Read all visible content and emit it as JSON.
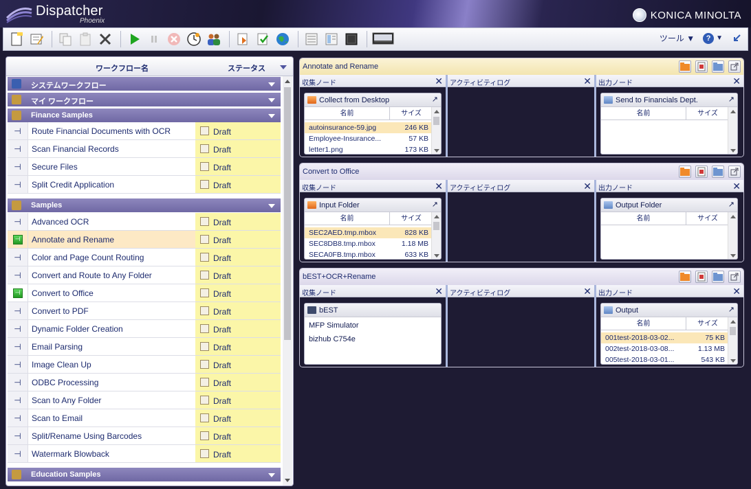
{
  "app": {
    "name": "Dispatcher",
    "subtitle": "Phoenix",
    "brand": "KONICA MINOLTA"
  },
  "toolbar": {
    "tools_label": "ツール ▼",
    "help_label": "?",
    "help_arrow": "▼"
  },
  "left_panel": {
    "col_name": "ワークフロー名",
    "col_status": "ステータス",
    "groups": [
      {
        "label": "システムワークフロー"
      },
      {
        "label": "マイ ワークフロー"
      },
      {
        "label": "Finance Samples"
      },
      {
        "label": "Samples"
      },
      {
        "label": "Education Samples"
      }
    ],
    "finance_rows": [
      {
        "name": "Route Financial Documents with OCR",
        "status": "Draft"
      },
      {
        "name": "Scan Financial Records",
        "status": "Draft"
      },
      {
        "name": "Secure Files",
        "status": "Draft"
      },
      {
        "name": "Split Credit Application",
        "status": "Draft"
      }
    ],
    "sample_rows": [
      {
        "name": "Advanced OCR",
        "status": "Draft"
      },
      {
        "name": "Annotate and Rename",
        "status": "Draft"
      },
      {
        "name": "Color and Page Count Routing",
        "status": "Draft"
      },
      {
        "name": "Convert and Route to Any Folder",
        "status": "Draft"
      },
      {
        "name": "Convert to Office",
        "status": "Draft"
      },
      {
        "name": "Convert to PDF",
        "status": "Draft"
      },
      {
        "name": "Dynamic Folder Creation",
        "status": "Draft"
      },
      {
        "name": "Email Parsing",
        "status": "Draft"
      },
      {
        "name": "Image Clean Up",
        "status": "Draft"
      },
      {
        "name": "ODBC Processing",
        "status": "Draft"
      },
      {
        "name": "Scan to Any Folder",
        "status": "Draft"
      },
      {
        "name": "Scan to Email",
        "status": "Draft"
      },
      {
        "name": "Split/Rename Using Barcodes",
        "status": "Draft"
      },
      {
        "name": "Watermark Blowback",
        "status": "Draft"
      }
    ]
  },
  "pane_labels": {
    "collect": "収集ノード",
    "activity": "アクティビティログ",
    "output": "出力ノード",
    "col_name": "名前",
    "col_size": "サイズ"
  },
  "workflows": [
    {
      "title": "Annotate and Rename",
      "collect": {
        "title": "Collect from Desktop",
        "files": [
          {
            "name": "autoinsurance-59.jpg",
            "size": "246 KB"
          },
          {
            "name": "Employee-Insurance...",
            "size": "57 KB"
          },
          {
            "name": "letter1.png",
            "size": "173 KB"
          }
        ]
      },
      "output": {
        "title": "Send to Financials Dept.",
        "files": []
      }
    },
    {
      "title": "Convert to Office",
      "collect": {
        "title": "Input Folder",
        "files": [
          {
            "name": "SEC2AED.tmp.mbox",
            "size": "828 KB"
          },
          {
            "name": "SEC8DB8.tmp.mbox",
            "size": "1.18 MB"
          },
          {
            "name": "SECA0FB.tmp.mbox",
            "size": "633 KB"
          }
        ]
      },
      "output": {
        "title": "Output Folder",
        "files": []
      }
    },
    {
      "title": "bEST+OCR+Rename",
      "collect": {
        "title": "bEST",
        "line1": "MFP Simulator",
        "line2": "bizhub C754e"
      },
      "output": {
        "title": "Output",
        "files": [
          {
            "name": "001test-2018-03-02...",
            "size": "75 KB"
          },
          {
            "name": "002test-2018-03-08...",
            "size": "1.13 MB"
          },
          {
            "name": "005test-2018-03-01...",
            "size": "543 KB"
          }
        ]
      }
    }
  ]
}
